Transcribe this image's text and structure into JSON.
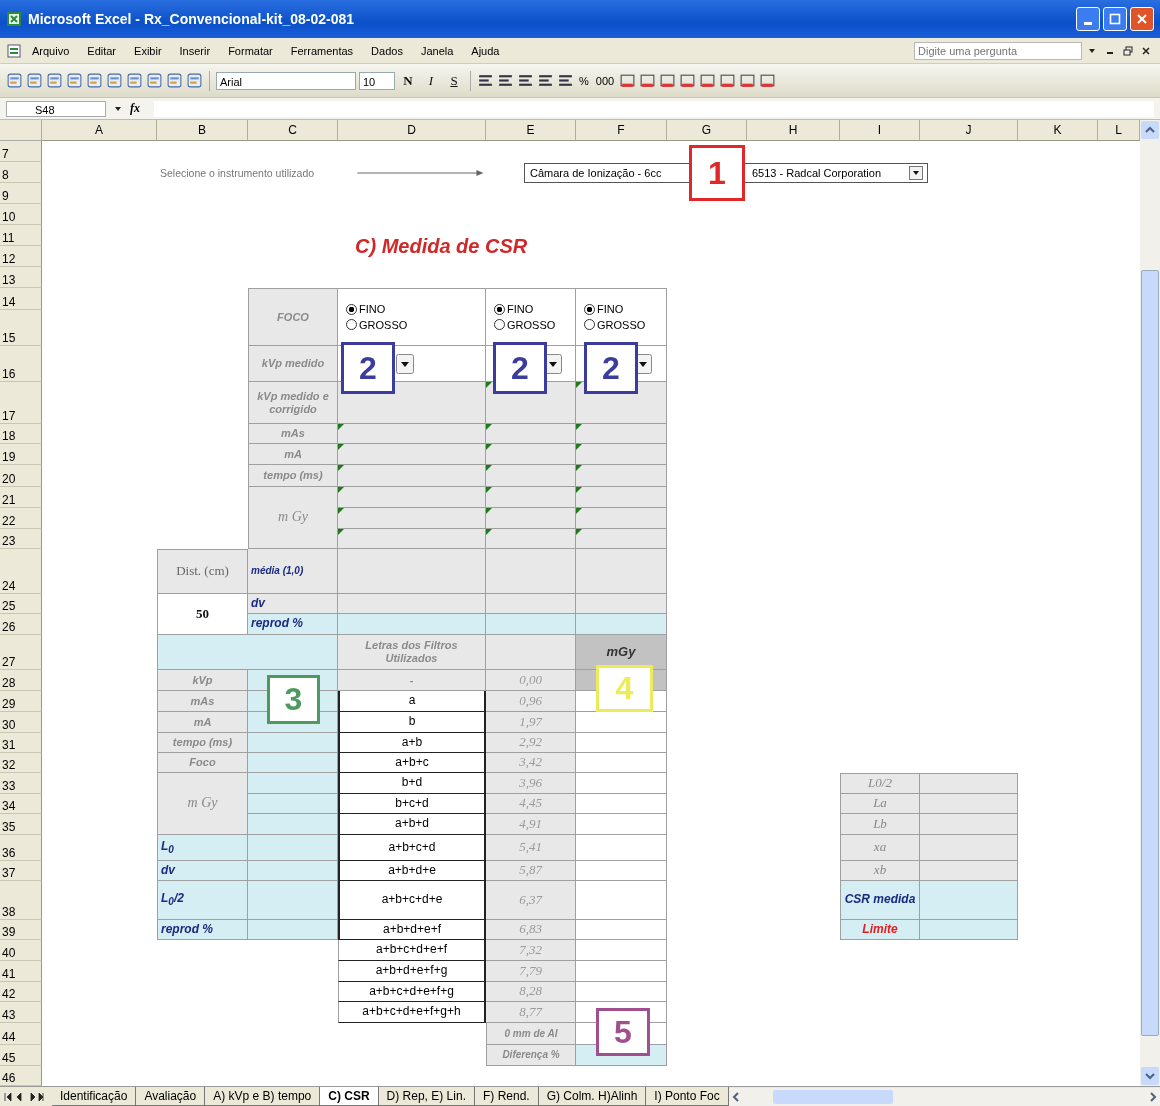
{
  "window": {
    "title": "Microsoft Excel - Rx_Convencional-kit_08-02-081"
  },
  "menu": {
    "items": [
      "Arquivo",
      "Editar",
      "Exibir",
      "Inserir",
      "Formatar",
      "Ferramentas",
      "Dados",
      "Janela",
      "Ajuda"
    ],
    "help_search": {
      "placeholder": "Digite uma pergunta"
    }
  },
  "toolbar": {
    "font": "Arial",
    "font_size": "10",
    "format_buttons": [
      {
        "label": "N",
        "kind": "bold"
      },
      {
        "label": "I",
        "kind": "italic"
      },
      {
        "label": "S",
        "kind": "underline"
      }
    ],
    "number_buttons": [
      "%",
      "000"
    ]
  },
  "formula_bar": {
    "name_box": "S48",
    "function_label": "fx"
  },
  "columns": [
    "A",
    "B",
    "C",
    "D",
    "E",
    "F",
    "G",
    "H",
    "I",
    "J",
    "K",
    "L"
  ],
  "rows": [
    "7",
    "8",
    "9",
    "10",
    "11",
    "12",
    "13",
    "14",
    "15",
    "16",
    "17",
    "18",
    "19",
    "20",
    "21",
    "22",
    "23",
    "24",
    "25",
    "26",
    "27",
    "28",
    "29",
    "30",
    "31",
    "32",
    "33",
    "34",
    "35",
    "36",
    "37",
    "38",
    "39",
    "40",
    "41",
    "42",
    "43",
    "44",
    "45",
    "46"
  ],
  "instrument": {
    "label": "Selecione o instrumento utilizado",
    "value_start": "Câmara de Ionização - 6cc",
    "value_end": "6513 - Radcal Corporation"
  },
  "section_title": "C) Medida de CSR",
  "measurement": {
    "row_labels": [
      "FOCO",
      "kVp medido",
      "kVp medido e corrigido",
      "mAs",
      "mA",
      "tempo (ms)",
      "m Gy"
    ],
    "columns": [
      {
        "focus": [
          {
            "label": "FINO",
            "selected": true
          },
          {
            "label": "GROSSO",
            "selected": false
          }
        ]
      },
      {
        "focus": [
          {
            "label": "FINO",
            "selected": true
          },
          {
            "label": "GROSSO",
            "selected": false
          }
        ]
      },
      {
        "focus": [
          {
            "label": "FINO",
            "selected": true
          },
          {
            "label": "GROSSO",
            "selected": false
          }
        ]
      }
    ]
  },
  "summary": {
    "distance_label": "Dist. (cm)",
    "distance": "50",
    "row_labels": [
      "média (1,0)",
      "dv",
      "reprod %"
    ]
  },
  "parameters": [
    {
      "label": "kVp",
      "kind": "setting"
    },
    {
      "label": "mAs",
      "kind": "setting"
    },
    {
      "label": "mA",
      "kind": "setting"
    },
    {
      "label": "tempo (ms)",
      "kind": "setting"
    },
    {
      "label": "Foco",
      "kind": "setting"
    },
    {
      "label": "m Gy",
      "kind": "setting"
    },
    {
      "label": "L$_{0}$",
      "kind": "result"
    },
    {
      "label": "dv",
      "kind": "result"
    },
    {
      "label": "L$_{0}$/2",
      "kind": "result"
    },
    {
      "label": "reprod %",
      "kind": "result"
    }
  ],
  "filters": {
    "header": "Letras dos Filtros Utilizados",
    "dose_header": "mGy",
    "rows": [
      {
        "letters": "-",
        "thickness": "0,00"
      },
      {
        "letters": "a",
        "thickness": "0,96"
      },
      {
        "letters": "b",
        "thickness": "1,97"
      },
      {
        "letters": "a+b",
        "thickness": "2,92"
      },
      {
        "letters": "a+b+c",
        "thickness": "3,42"
      },
      {
        "letters": "b+d",
        "thickness": "3,96"
      },
      {
        "letters": "b+c+d",
        "thickness": "4,45"
      },
      {
        "letters": "a+b+d",
        "thickness": "4,91"
      },
      {
        "letters": "a+b+c+d",
        "thickness": "5,41"
      },
      {
        "letters": "a+b+d+e",
        "thickness": "5,87"
      },
      {
        "letters": "a+b+c+d+e",
        "thickness": "6,37"
      },
      {
        "letters": "a+b+d+e+f",
        "thickness": "6,83"
      },
      {
        "letters": "a+b+c+d+e+f",
        "thickness": "7,32"
      },
      {
        "letters": "a+b+d+e+f+g",
        "thickness": "7,79"
      },
      {
        "letters": "a+b+c+d+e+f+g",
        "thickness": "8,28"
      },
      {
        "letters": "a+b+c+d+e+f+g+h",
        "thickness": "8,77"
      }
    ],
    "footer_labels": [
      "0 mm de Al",
      "Diferença %"
    ]
  },
  "csr_table": [
    {
      "label": "L0/2",
      "kind": "input"
    },
    {
      "label": "La",
      "kind": "input"
    },
    {
      "label": "Lb",
      "kind": "input"
    },
    {
      "label": "xa",
      "kind": "input"
    },
    {
      "label": "xb",
      "kind": "input"
    },
    {
      "label": "CSR medida",
      "kind": "result"
    },
    {
      "label": "Limite",
      "kind": "limit"
    }
  ],
  "callouts": [
    {
      "number": "1",
      "color": "#e02828"
    },
    {
      "number": "2",
      "color": "#3c3c9c"
    },
    {
      "number": "2",
      "color": "#3c3c9c"
    },
    {
      "number": "2",
      "color": "#3c3c9c"
    },
    {
      "number": "3",
      "color": "#4e9a5e"
    },
    {
      "number": "4",
      "color": "#ecec5a"
    },
    {
      "number": "5",
      "color": "#a0508e"
    }
  ],
  "sheet_tabs": [
    {
      "label": "Identificação",
      "selected": false
    },
    {
      "label": "Avaliação",
      "selected": false
    },
    {
      "label": "A) kVp e B) tempo",
      "selected": false
    },
    {
      "label": "C) CSR",
      "selected": true
    },
    {
      "label": "D) Rep, E) Lin.",
      "selected": false
    },
    {
      "label": "F) Rend.",
      "selected": false
    },
    {
      "label": "G) Colm. H)Alinh",
      "selected": false
    },
    {
      "label": "I) Ponto Foc",
      "selected": false
    }
  ]
}
